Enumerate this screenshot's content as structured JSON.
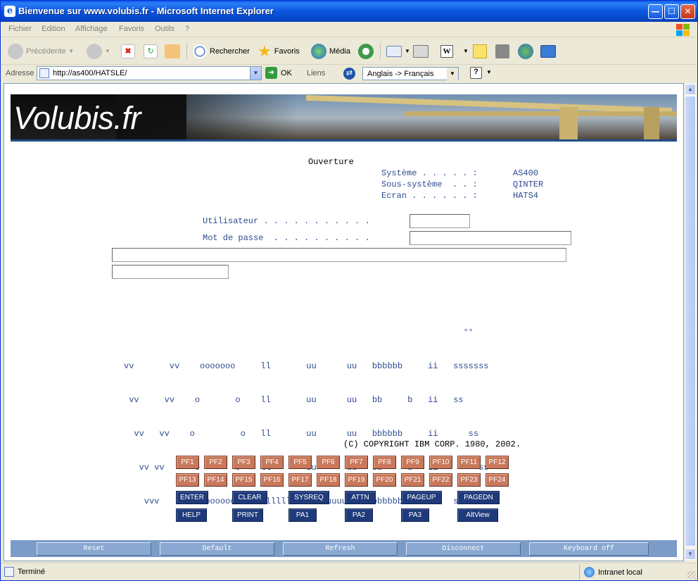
{
  "window": {
    "title": "Bienvenue sur www.volubis.fr - Microsoft Internet Explorer",
    "app_icon": "ie-icon",
    "controls": {
      "minimize": "—",
      "maximize": "☐",
      "close": "✕"
    }
  },
  "menu": [
    "Fichier",
    "Edition",
    "Affichage",
    "Favoris",
    "Outils",
    "?"
  ],
  "toolbar": {
    "back": "Précédente",
    "search": "Rechercher",
    "favorites": "Favoris",
    "media": "Média"
  },
  "address": {
    "label": "Adresse",
    "url": "http://as400/HATSLE/",
    "go": "OK",
    "links": "Liens",
    "translate": "Anglais -> Français"
  },
  "banner": {
    "logo": "Volubis.fr"
  },
  "screen": {
    "title": "Ouverture",
    "system_label": "Système . . . . . :",
    "system_value": "AS400",
    "subsystem_label": "Sous-système  . . :",
    "subsystem_value": "QINTER",
    "screen_label": "Ecran . . . . . . :",
    "screen_value": "HATS4",
    "user_label": "Utilisateur . . . . . . . . . . .",
    "user_value": "",
    "password_label": "Mot de passe  . . . . . . . . . .",
    "password_value": "",
    "art": [
      "                                                                   °°",
      "vv       vv    ooooooo     ll       uu      uu   bbbbbb     ii   sssssss",
      " vv     vv    o       o    ll       uu      uu   bb     b   ii   ss",
      "  vv   vv    o         o   ll       uu      uu   bbbbbb     ii      ss",
      "   vv vv      o       o    ll       uu      uu   bb     b   ii        ss",
      "    vvv        ooooooo     llllllll  uuuuuuuu    bbbbbb     ii   sssssss"
    ],
    "copyright": "(C) COPYRIGHT IBM CORP. 1980, 2002."
  },
  "pf_keys_row1": [
    "PF1",
    "PF2",
    "PF3",
    "PF4",
    "PF5",
    "PF6",
    "PF7",
    "PF8",
    "PF9",
    "PF10",
    "PF11",
    "PF12"
  ],
  "pf_keys_row2": [
    "PF13",
    "PF14",
    "PF15",
    "PF16",
    "PF17",
    "PF18",
    "PF19",
    "PF20",
    "PF21",
    "PF22",
    "PF23",
    "PF24"
  ],
  "fn_keys_row1": [
    "ENTER",
    "CLEAR",
    "SYSREQ",
    "ATTN",
    "PAGEUP",
    "PAGEDN"
  ],
  "fn_keys_row2": [
    "HELP",
    "PRINT",
    "PA1",
    "PA2",
    "PA3",
    "AltView"
  ],
  "bottom_buttons": [
    "Reset",
    "Default",
    "Refresh",
    "Disconnect",
    "Keyboard off"
  ],
  "status": {
    "text": "Terminé",
    "zone": "Intranet local"
  },
  "colors": {
    "pf_button": "#c9785b",
    "fn_button": "#1f3a7a",
    "bottom_bar": "#7b9cc7",
    "terminal_text": "#2e4a8f"
  }
}
